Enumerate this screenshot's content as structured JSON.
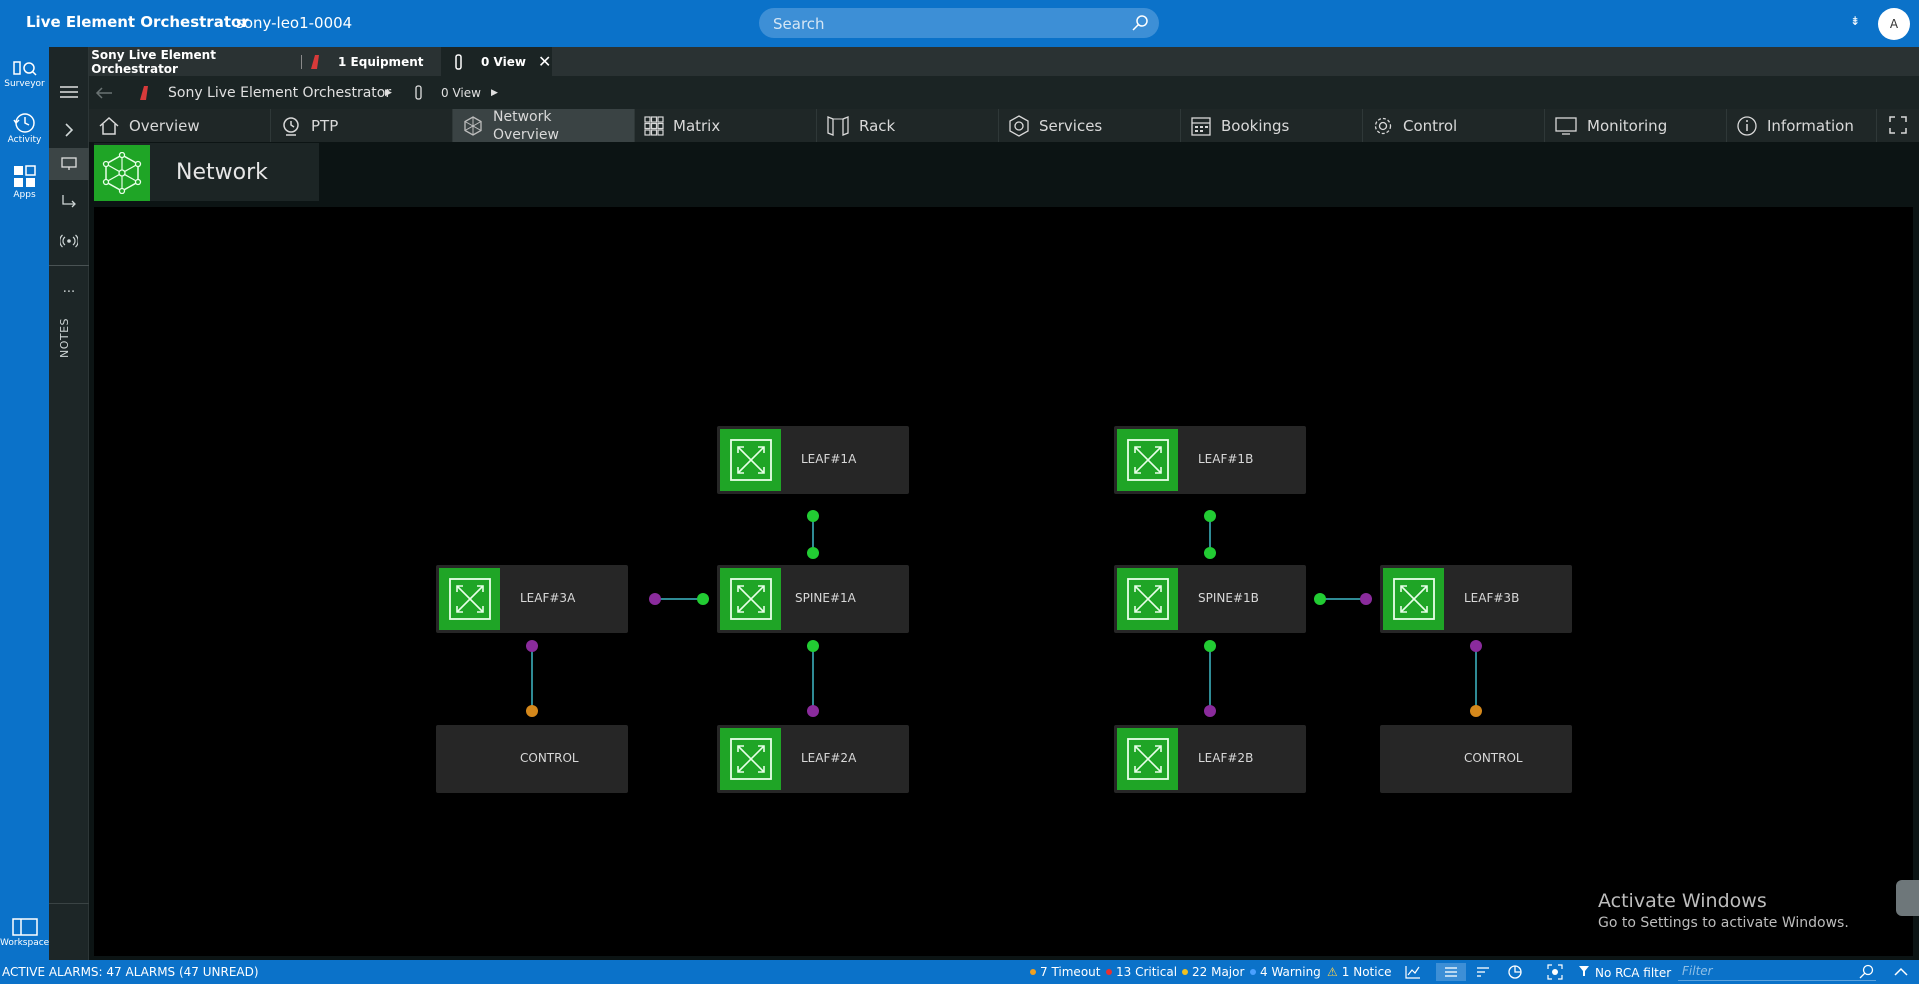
{
  "topbar": {
    "app_title": "Live Element Orchestrator",
    "host": "sony-leo1-0004",
    "search_placeholder": "Search",
    "user_initial": "A",
    "user_menu_glyph": "⇟"
  },
  "left_rail": {
    "items": [
      {
        "label": "Surveyor",
        "icon": "surveyor-icon"
      },
      {
        "label": "Activity",
        "icon": "activity-icon"
      },
      {
        "label": "Apps",
        "icon": "apps-icon"
      }
    ],
    "bottom": {
      "label": "Workspace",
      "icon": "workspace-icon"
    }
  },
  "side_panel": {
    "notes_label": "NOTES",
    "more_glyph": "···"
  },
  "doc_tabs": [
    {
      "label": "Sony Live Element Orchestrator",
      "active": false
    },
    {
      "label": "1 Equipment",
      "active": false
    },
    {
      "label": "0 View",
      "active": true
    }
  ],
  "breadcrumb": {
    "items": [
      "Sony Live Element Orchestrator",
      "0 View"
    ]
  },
  "nav_tabs": [
    {
      "label": "Overview",
      "icon": "home-icon"
    },
    {
      "label": "PTP",
      "icon": "clock-icon"
    },
    {
      "label": "Network Overview",
      "icon": "network-icon",
      "active": true
    },
    {
      "label": "Matrix",
      "icon": "grid-icon"
    },
    {
      "label": "Rack",
      "icon": "rack-icon"
    },
    {
      "label": "Services",
      "icon": "services-icon"
    },
    {
      "label": "Bookings",
      "icon": "calendar-icon"
    },
    {
      "label": "Control",
      "icon": "gear-icon"
    },
    {
      "label": "Monitoring",
      "icon": "monitor-icon"
    },
    {
      "label": "Information",
      "icon": "info-icon"
    }
  ],
  "page": {
    "title": "Network"
  },
  "diagram": {
    "nodes": [
      {
        "id": "leaf1a",
        "label": "LEAF#1A",
        "icon": true
      },
      {
        "id": "leaf1b",
        "label": "LEAF#1B",
        "icon": true
      },
      {
        "id": "leaf3a",
        "label": "LEAF#3A",
        "icon": true
      },
      {
        "id": "spine1a",
        "label": "SPINE#1A",
        "icon": true
      },
      {
        "id": "spine1b",
        "label": "SPINE#1B",
        "icon": true
      },
      {
        "id": "leaf3b",
        "label": "LEAF#3B",
        "icon": true
      },
      {
        "id": "control1",
        "label": "CONTROL",
        "icon": false
      },
      {
        "id": "leaf2a",
        "label": "LEAF#2A",
        "icon": true
      },
      {
        "id": "leaf2b",
        "label": "LEAF#2B",
        "icon": true
      },
      {
        "id": "control2",
        "label": "CONTROL",
        "icon": false
      }
    ],
    "colors": {
      "port_green": "#22cc33",
      "port_purple": "#8a2b9c",
      "port_orange": "#d5881b",
      "link": "#2f8b95",
      "node_icon": "#1fa526"
    }
  },
  "watermark": {
    "title": "Activate Windows",
    "subtitle": "Go to Settings to activate Windows."
  },
  "statusbar": {
    "active_alarms": "ACTIVE ALARMS: 47 ALARMS (47 UNREAD)",
    "counts": [
      {
        "label": "7 Timeout",
        "color": "#f0a020"
      },
      {
        "label": "13 Critical",
        "color": "#e83030"
      },
      {
        "label": "22 Major",
        "color": "#f0c020"
      },
      {
        "label": "4 Warning",
        "color": "#4aa0ff"
      },
      {
        "label": "1 Notice",
        "icon": "warning-icon"
      }
    ],
    "rca_filter": "No RCA filter",
    "filter_placeholder": "Filter"
  }
}
